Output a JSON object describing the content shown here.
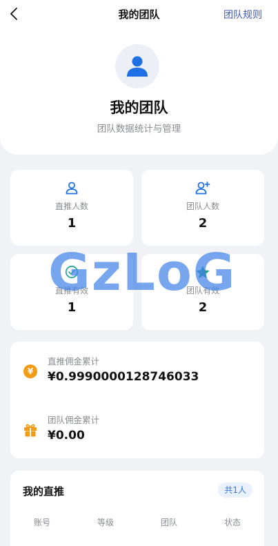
{
  "nav": {
    "title": "我的团队",
    "rules_link": "团队规则"
  },
  "hero": {
    "title": "我的团队",
    "subtitle": "团队数据统计与管理"
  },
  "stats": [
    {
      "label": "直推人数",
      "value": "1",
      "icon": "person-icon"
    },
    {
      "label": "团队人数",
      "value": "2",
      "icon": "person-add-icon"
    },
    {
      "label": "直推有效",
      "value": "1",
      "icon": "check-circle-icon"
    },
    {
      "label": "团队有效",
      "value": "2",
      "icon": "star-icon"
    }
  ],
  "commission": [
    {
      "label": "直推佣金累计",
      "value": "¥0.9990000128746033",
      "icon": "yen-coin-icon",
      "icon_symbol": "¥"
    },
    {
      "label": "团队佣金累计",
      "value": "¥0.00",
      "icon": "gift-icon"
    }
  ],
  "direct": {
    "title": "我的直推",
    "count_badge": "共1人",
    "columns": [
      "账号",
      "等级",
      "团队",
      "状态"
    ]
  },
  "watermark": "GzLoG",
  "colors": {
    "accent_blue": "#1f6fe5",
    "rule_link": "#3f5bb2",
    "coin_orange": "#f39a16",
    "star_teal": "#1e9c8c",
    "check_green": "#2aa79a"
  }
}
